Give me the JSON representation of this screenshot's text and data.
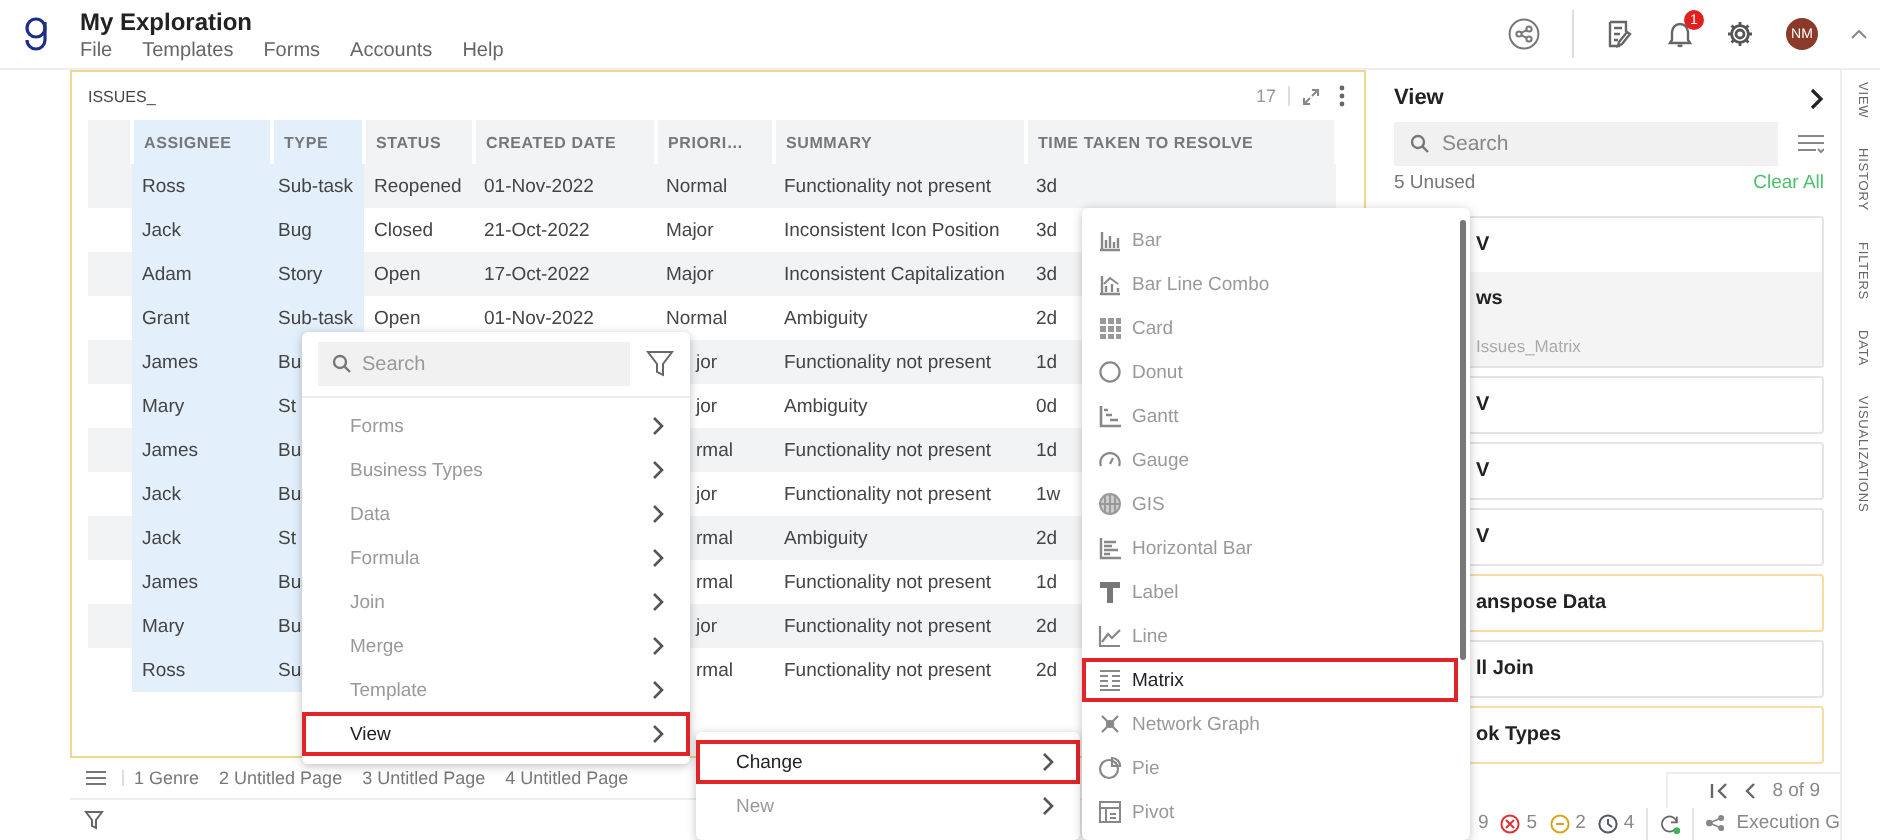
{
  "app": {
    "title": "My Exploration",
    "menu": [
      "File",
      "Templates",
      "Forms",
      "Accounts",
      "Help"
    ],
    "notifications": "1",
    "avatar": "NM"
  },
  "widget": {
    "title": "ISSUES_",
    "count": "17",
    "columns": [
      {
        "label": "ASSIGNEE",
        "selected": true
      },
      {
        "label": "TYPE",
        "selected": true
      },
      {
        "label": "STATUS",
        "selected": false
      },
      {
        "label": "CREATED DATE",
        "selected": false
      },
      {
        "label": "PRIORI…",
        "selected": false
      },
      {
        "label": "SUMMARY",
        "selected": false
      },
      {
        "label": "TIME TAKEN TO RESOLVE",
        "selected": false
      }
    ],
    "rows": [
      [
        "Ross",
        "Sub-task",
        "Reopened",
        "01-Nov-2022",
        "Normal",
        "Functionality not present",
        "3d"
      ],
      [
        "Jack",
        "Bug",
        "Closed",
        "21-Oct-2022",
        "Major",
        "Inconsistent Icon Position",
        "3d"
      ],
      [
        "Adam",
        "Story",
        "Open",
        "17-Oct-2022",
        "Major",
        "Inconsistent Capitalization",
        "3d"
      ],
      [
        "Grant",
        "Sub-task",
        "Open",
        "01-Nov-2022",
        "Normal",
        "Ambiguity",
        "2d"
      ],
      [
        "James",
        "Bu",
        null,
        null,
        "jor",
        "Functionality not present",
        "1d"
      ],
      [
        "Mary",
        "St",
        null,
        null,
        "jor",
        "Ambiguity",
        "0d"
      ],
      [
        "James",
        "Bu",
        null,
        null,
        "rmal",
        "Functionality not present",
        "1d"
      ],
      [
        "Jack",
        "Bu",
        null,
        null,
        "jor",
        "Functionality not present",
        "1w"
      ],
      [
        "Jack",
        "St",
        null,
        null,
        "rmal",
        "Ambiguity",
        "2d"
      ],
      [
        "James",
        "Bu",
        null,
        null,
        "rmal",
        "Functionality not present",
        "1d"
      ],
      [
        "Mary",
        "Bu",
        null,
        null,
        "jor",
        "Functionality not present",
        "2d"
      ],
      [
        "Ross",
        "Su",
        null,
        null,
        "rmal",
        "Functionality not present",
        "2d"
      ]
    ],
    "pages": [
      "1 Genre",
      "2 Untitled Page",
      "3 Untitled Page",
      "4 Untitled Page"
    ]
  },
  "context_menu": {
    "placeholder": "Search",
    "items": [
      {
        "label": "Forms",
        "highlighted": false
      },
      {
        "label": "Business Types",
        "highlighted": false
      },
      {
        "label": "Data",
        "highlighted": false
      },
      {
        "label": "Formula",
        "highlighted": false
      },
      {
        "label": "Join",
        "highlighted": false
      },
      {
        "label": "Merge",
        "highlighted": false
      },
      {
        "label": "Template",
        "highlighted": false
      },
      {
        "label": "View",
        "highlighted": true
      }
    ]
  },
  "view_submenu": {
    "items": [
      {
        "label": "Change",
        "highlighted": true
      },
      {
        "label": "New",
        "highlighted": false
      }
    ]
  },
  "chart_menu": {
    "items": [
      {
        "label": "Bar",
        "kind": "bar",
        "highlighted": false
      },
      {
        "label": "Bar Line Combo",
        "kind": "combo",
        "highlighted": false
      },
      {
        "label": "Card",
        "kind": "card",
        "highlighted": false
      },
      {
        "label": "Donut",
        "kind": "donut",
        "highlighted": false
      },
      {
        "label": "Gantt",
        "kind": "gantt",
        "highlighted": false
      },
      {
        "label": "Gauge",
        "kind": "gauge",
        "highlighted": false
      },
      {
        "label": "GIS",
        "kind": "gis",
        "highlighted": false
      },
      {
        "label": "Horizontal Bar",
        "kind": "hbar",
        "highlighted": false
      },
      {
        "label": "Label",
        "kind": "label",
        "highlighted": false
      },
      {
        "label": "Line",
        "kind": "line",
        "highlighted": false
      },
      {
        "label": "Matrix",
        "kind": "matrix",
        "highlighted": true
      },
      {
        "label": "Network Graph",
        "kind": "network",
        "highlighted": false
      },
      {
        "label": "Pie",
        "kind": "pie",
        "highlighted": false
      },
      {
        "label": "Pivot",
        "kind": "pivot",
        "highlighted": false
      }
    ]
  },
  "view_panel": {
    "title": "View",
    "placeholder": "Search",
    "unused": "5 Unused",
    "clear": "Clear All",
    "cards": [
      {
        "lines": [
          "V",
          "ws",
          "Issues_Matrix"
        ],
        "flagged": false
      },
      {
        "lines": [
          "V"
        ],
        "flagged": false
      },
      {
        "lines": [
          "V"
        ],
        "flagged": false
      },
      {
        "lines": [
          "V"
        ],
        "flagged": false
      },
      {
        "lines": [
          "anspose Data"
        ],
        "flagged": true
      },
      {
        "lines": [
          "ll Join"
        ],
        "flagged": false
      },
      {
        "lines": [
          "ok Types"
        ],
        "flagged": true
      }
    ],
    "pager": "8 of 9",
    "status": [
      {
        "kind": "plain",
        "text": "9"
      },
      {
        "kind": "error",
        "text": "5"
      },
      {
        "kind": "warning",
        "text": "2"
      },
      {
        "kind": "pending",
        "text": "4"
      }
    ],
    "execution": "Execution G"
  },
  "side_tabs": [
    "VIEW",
    "HISTORY",
    "FILTERS",
    "DATA",
    "VISUALIZATIONS"
  ]
}
